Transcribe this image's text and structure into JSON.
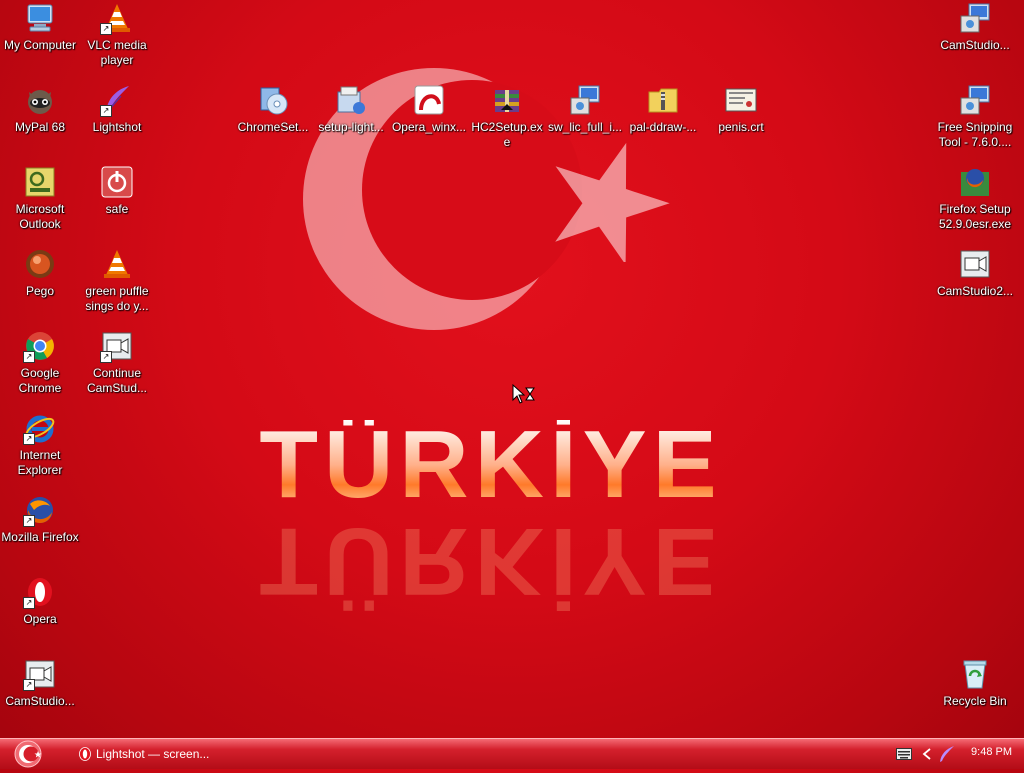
{
  "wallpaper": {
    "text": "TÜRKİYE"
  },
  "icons": [
    {
      "id": "my-computer",
      "label": "My Computer",
      "icon": "computer-icon",
      "col": 0,
      "row": 0
    },
    {
      "id": "vlc",
      "label": "VLC media player",
      "icon": "vlc-cone-icon",
      "col": 1,
      "row": 0
    },
    {
      "id": "mypal",
      "label": "MyPal 68",
      "icon": "raccoon-icon",
      "col": 0,
      "row": 1
    },
    {
      "id": "lightshot",
      "label": "Lightshot",
      "icon": "feather-icon",
      "col": 1,
      "row": 1
    },
    {
      "id": "outlook",
      "label": "Microsoft Outlook",
      "icon": "outlook-icon",
      "col": 0,
      "row": 2
    },
    {
      "id": "safe",
      "label": "safe",
      "icon": "power-icon",
      "col": 1,
      "row": 2
    },
    {
      "id": "pego",
      "label": "Pego",
      "icon": "pego-icon",
      "col": 0,
      "row": 3
    },
    {
      "id": "green-puffle",
      "label": "green puffle sings do y...",
      "icon": "vlc-cone-icon",
      "col": 1,
      "row": 3
    },
    {
      "id": "chrome",
      "label": "Google Chrome",
      "icon": "chrome-icon",
      "col": 0,
      "row": 4
    },
    {
      "id": "continue-camstudio",
      "label": "Continue CamStud...",
      "icon": "camstudio-icon",
      "col": 1,
      "row": 4
    },
    {
      "id": "ie",
      "label": "Internet Explorer",
      "icon": "ie-icon",
      "col": 0,
      "row": 5
    },
    {
      "id": "firefox",
      "label": "Mozilla Firefox",
      "icon": "firefox-icon",
      "col": 0,
      "row": 6
    },
    {
      "id": "opera",
      "label": "Opera",
      "icon": "opera-icon",
      "col": 0,
      "row": 7
    },
    {
      "id": "camstudio-left",
      "label": "CamStudio...",
      "icon": "camstudio-icon",
      "col": 0,
      "row": 8
    }
  ],
  "top_icons": [
    {
      "id": "chromeset",
      "label": "ChromeSet...",
      "icon": "installer-disc-icon"
    },
    {
      "id": "setup-light",
      "label": "setup-light...",
      "icon": "setup-icon"
    },
    {
      "id": "opera-win",
      "label": "Opera_winx...",
      "icon": "opera-installer-icon"
    },
    {
      "id": "hc2setup",
      "label": "HC2Setup.exe",
      "icon": "winrar-icon"
    },
    {
      "id": "sw-lic",
      "label": "sw_lic_full_i...",
      "icon": "installer-monitor-icon"
    },
    {
      "id": "pal-ddraw",
      "label": "pal-ddraw-...",
      "icon": "zip-folder-icon"
    },
    {
      "id": "penis-crt",
      "label": "penis.crt",
      "icon": "certificate-icon"
    }
  ],
  "right_icons": [
    {
      "id": "camstudio-r1",
      "label": "CamStudio...",
      "icon": "installer-monitor-icon"
    },
    {
      "id": "free-snipping",
      "label": "Free Snipping Tool - 7.6.0....",
      "icon": "installer-monitor-icon"
    },
    {
      "id": "firefox-setup",
      "label": "Firefox Setup 52.9.0esr.exe",
      "icon": "firefox-setup-icon"
    },
    {
      "id": "camstudio2",
      "label": "CamStudio2...",
      "icon": "camstudio-icon"
    },
    {
      "id": "recycle-bin",
      "label": "Recycle Bin",
      "icon": "recycle-bin-icon"
    }
  ],
  "taskbar": {
    "task_label": "Lightshot — screen...",
    "clock": "9:48 PM"
  },
  "colors": {
    "wallpaper": "#d40a16",
    "taskbar": "#c81a25"
  }
}
